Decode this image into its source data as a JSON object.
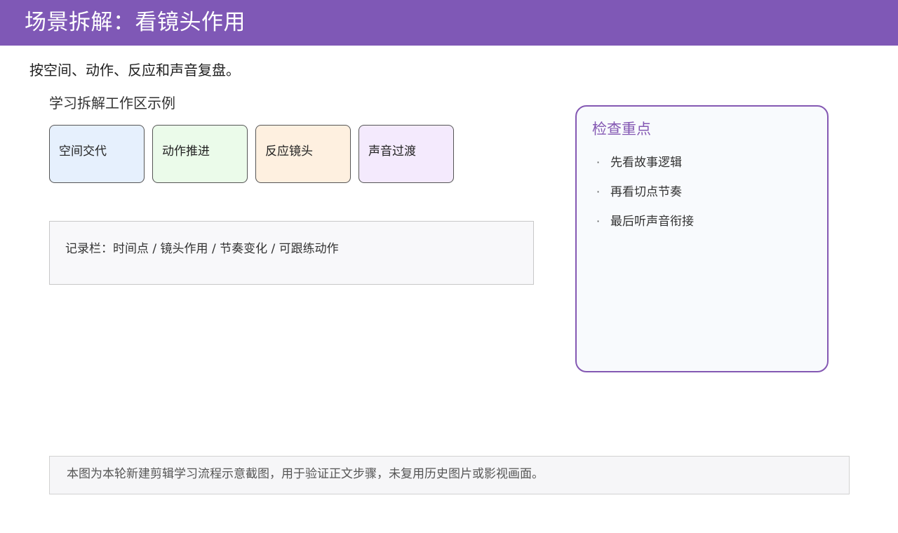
{
  "header": {
    "title": "场景拆解：看镜头作用",
    "background_color": "#7f58b6"
  },
  "subtitle": "按空间、动作、反应和声音复盘。",
  "workspace": {
    "label": "学习拆解工作区示例",
    "cards": [
      {
        "label": "空间交代",
        "color": "#e6f0fd"
      },
      {
        "label": "动作推进",
        "color": "#ebfbea"
      },
      {
        "label": "反应镜头",
        "color": "#fef0e0"
      },
      {
        "label": "声音过渡",
        "color": "#f4eafd"
      }
    ]
  },
  "record_bar": {
    "text": "记录栏：时间点 / 镜头作用 / 节奏变化 / 可跟练动作"
  },
  "check_panel": {
    "title": "检查重点",
    "accent_color": "#8458b3",
    "items": [
      "先看故事逻辑",
      "再看切点节奏",
      "最后听声音衔接"
    ],
    "bullet": "·"
  },
  "footer": {
    "note": "本图为本轮新建剪辑学习流程示意截图，用于验证正文步骤，未复用历史图片或影视画面。"
  }
}
